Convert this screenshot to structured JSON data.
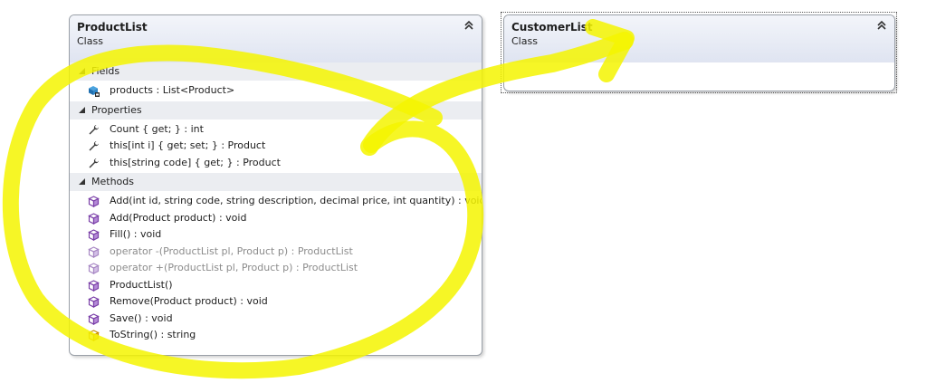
{
  "classes": {
    "product": {
      "name": "ProductList",
      "kind": "Class",
      "sections": {
        "fields": {
          "label": "Fields",
          "items": [
            {
              "text": "products : List<Product>",
              "icon": "field-icon"
            }
          ]
        },
        "properties": {
          "label": "Properties",
          "items": [
            {
              "text": "Count { get; } : int",
              "icon": "wrench-icon"
            },
            {
              "text": "this[int i] { get; set; } : Product",
              "icon": "wrench-icon"
            },
            {
              "text": "this[string code] { get; } : Product",
              "icon": "wrench-icon"
            }
          ]
        },
        "methods": {
          "label": "Methods",
          "items": [
            {
              "text": "Add(int id, string code, string description, decimal price, int quantity) : void",
              "icon": "method-icon"
            },
            {
              "text": "Add(Product product) : void",
              "icon": "method-icon"
            },
            {
              "text": "Fill() : void",
              "icon": "method-icon"
            },
            {
              "text": "operator -(ProductList pl, Product p) : ProductList",
              "icon": "method-icon"
            },
            {
              "text": "operator +(ProductList pl, Product p) : ProductList",
              "icon": "method-icon"
            },
            {
              "text": "ProductList()",
              "icon": "method-icon"
            },
            {
              "text": "Remove(Product product) : void",
              "icon": "method-icon"
            },
            {
              "text": "Save() : void",
              "icon": "method-icon"
            },
            {
              "text": "ToString() : string",
              "icon": "override-method-icon"
            }
          ]
        }
      }
    },
    "customer": {
      "name": "CustomerList",
      "kind": "Class"
    }
  },
  "colors": {
    "highlight": "#f7f700",
    "method_icon": "#7a3fa8",
    "override_icon": "#d8a000",
    "dim_text": "#8c8c8c"
  }
}
